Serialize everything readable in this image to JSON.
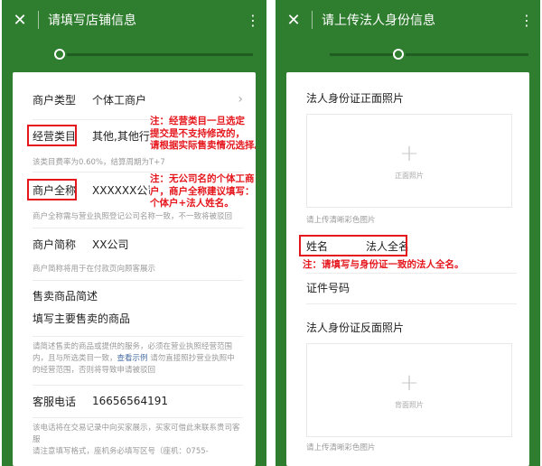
{
  "left": {
    "title": "请填写店铺信息",
    "close_icon": "close-icon",
    "more_icon": "more-vertical-icon",
    "rows": {
      "merchant_type": {
        "label": "商户类型",
        "value": "个体工商户"
      },
      "business_category": {
        "label": "经营类目",
        "value": "其他,其他行业"
      },
      "category_hint": "该类目费率为0.60%，结算周期为T+7",
      "full_name": {
        "label": "商户全称",
        "value": "XXXXXX公司"
      },
      "full_name_hint": "商户全称需与营业执照登记公司名称一致，不一致将被驳回",
      "short_name": {
        "label": "商户简称",
        "value": "XX公司"
      },
      "short_name_hint": "商户简称将用于在付款页向顾客展示",
      "goods_title": "售卖商品简述",
      "goods_value": "填写主要售卖的商品",
      "goods_hint_1": "请简述售卖的商品或提供的服务，必须在营业执照经营范围",
      "goods_hint_2a": "内，且与所选类目一致，",
      "goods_hint_link": "查看示例",
      "goods_hint_2b": " 请勿直接照抄营业执照中",
      "goods_hint_3": "的经营范围，否则将导致申请被驳回",
      "phone": {
        "label": "客服电话",
        "value": "16656564191"
      },
      "phone_hint_1": "该电话将在交易记录中向买家展示，买家可借此来联系贵司客",
      "phone_hint_2": "服",
      "phone_hint_3": "请注意填写格式，座机务必填写区号（座机：0755-"
    },
    "notes": {
      "category_1": "注：经营类目一旦选定",
      "category_2": "提交是不支持修改的，",
      "category_3": "请根据实际售卖情况选择。",
      "name_1": "注：无公司名的个体工商",
      "name_2": "户，商户全称建议填写：",
      "name_3": "个体户+法人姓名。"
    }
  },
  "right": {
    "title": "请上传法人身份信息",
    "close_icon": "close-icon",
    "more_icon": "more-vertical-icon",
    "front_title": "法人身份证正面照片",
    "front_caption": "正面照片",
    "front_hint": "请上传清晰彩色图片",
    "name_label": "姓名",
    "name_value": "法人全名",
    "name_note": "注：请填写与身份证一致的法人全名。",
    "id_label": "证件号码",
    "back_title": "法人身份证反面照片",
    "back_caption": "背面照片",
    "back_hint": "请上传清晰彩色图片"
  },
  "colors": {
    "header_green": "#2f7d2f",
    "annotation_red": "#e5171d",
    "link_blue": "#4a6fa5"
  }
}
